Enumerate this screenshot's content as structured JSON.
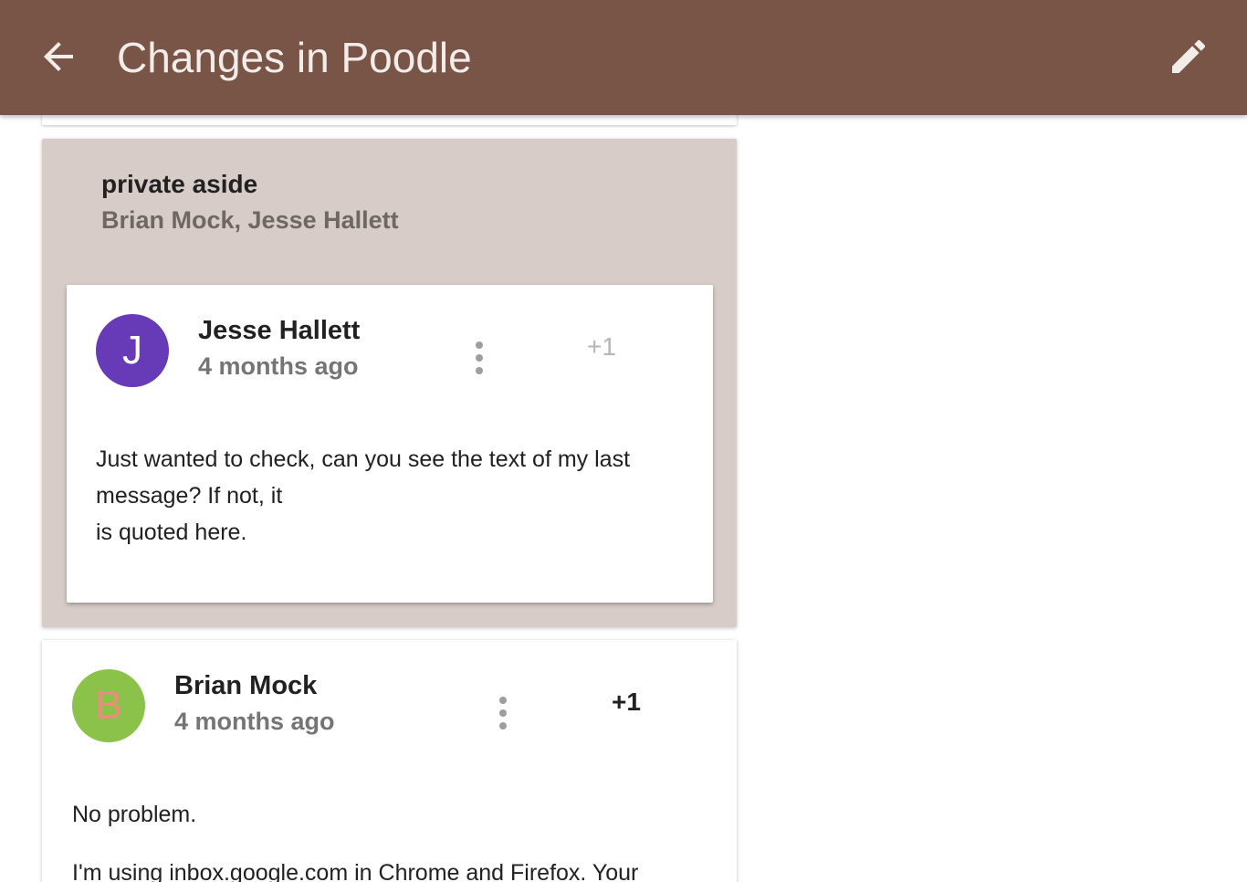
{
  "app_bar": {
    "title": "Changes in Poodle",
    "back_icon": "arrow-back-icon",
    "edit_icon": "pencil-icon",
    "background": "#795548"
  },
  "aside": {
    "title": "private aside",
    "participants": "Brian Mock, Jesse Hallett",
    "background": "#d7ccc8"
  },
  "messages": [
    {
      "avatar_letter": "J",
      "avatar_color": "#673ab7",
      "avatar_text_color": "#ffffff",
      "author": "Jesse Hallett",
      "time": "4 months ago",
      "more_icon": "more-vertical-icon",
      "plus_one": "+1",
      "body": [
        "Just wanted to check, can you see the text of my last",
        "message? If not, it",
        "is quoted here."
      ]
    },
    {
      "avatar_letter": "B",
      "avatar_color": "#8bc34a",
      "avatar_text_color": "#ef8a80",
      "author": "Brian Mock",
      "time": "4 months ago",
      "more_icon": "more-vertical-icon",
      "plus_one": "+1",
      "body": [
        "No problem.",
        "I'm using inbox.google.com in Chrome and Firefox. Your"
      ]
    }
  ]
}
